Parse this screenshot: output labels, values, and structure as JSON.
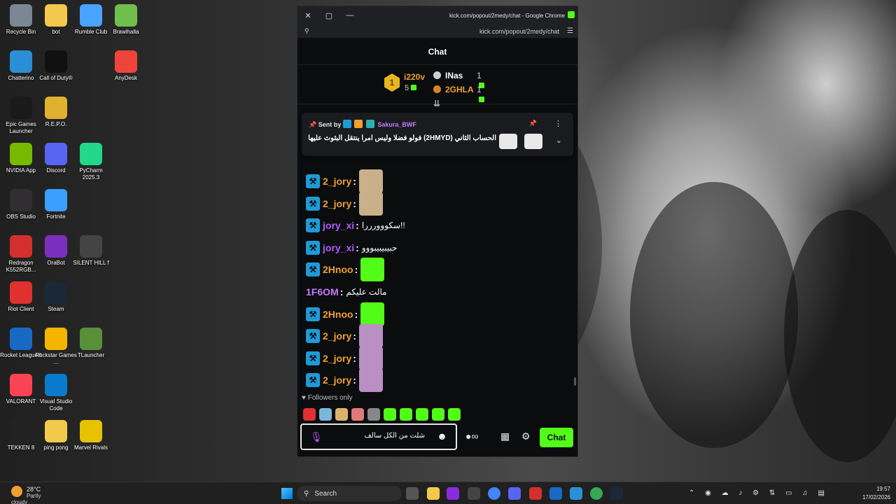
{
  "desktop": {
    "icons": [
      {
        "label": "Recycle Bin",
        "color": "#7b8794"
      },
      {
        "label": "bot",
        "color": "#f2c94c"
      },
      {
        "label": "Rumble Club",
        "color": "#4aa3ff"
      },
      {
        "label": "Brawlhalla",
        "color": "#6fbf4a"
      },
      {
        "label": "Chatterino",
        "color": "#2b8fd6"
      },
      {
        "label": "Call of Duty®",
        "color": "#111111"
      },
      {
        "label": "AnyDesk",
        "color": "#ef443b"
      },
      {
        "label": "Epic Games Launcher",
        "color": "#1a1a1a"
      },
      {
        "label": "R.E.P.O.",
        "color": "#e0b030"
      },
      {
        "label": "NVIDIA App",
        "color": "#76b900"
      },
      {
        "label": "Discord",
        "color": "#5865f2"
      },
      {
        "label": "PyCharm 2025.3",
        "color": "#21d789"
      },
      {
        "label": "OBS Studio",
        "color": "#302e31"
      },
      {
        "label": "Fortnite",
        "color": "#3aa0ff"
      },
      {
        "label": "Redragon K552RGB...",
        "color": "#d32f2f"
      },
      {
        "label": "OraBot",
        "color": "#7b2fbf"
      },
      {
        "label": "SILENT HILL f",
        "color": "#444444"
      },
      {
        "label": "Riot Client",
        "color": "#e03131"
      },
      {
        "label": "Steam",
        "color": "#1b2838"
      },
      {
        "label": "Rocket League®",
        "color": "#1769c4"
      },
      {
        "label": "Rockstar Games ...",
        "color": "#f5b400"
      },
      {
        "label": "TLauncher",
        "color": "#5a8f3a"
      },
      {
        "label": "VALORANT",
        "color": "#fa4454"
      },
      {
        "label": "Visual Studio Code",
        "color": "#0a7acc"
      },
      {
        "label": "TEKKEN 8",
        "color": "#222222"
      },
      {
        "label": "ping pong",
        "color": "#f2c94c"
      },
      {
        "label": "Marvel Rivals",
        "color": "#e6c200"
      }
    ]
  },
  "browser": {
    "title": "kick.com/popout/2medy/chat - Google Chrome",
    "url": "kick.com/popout/2medy/chat"
  },
  "chat": {
    "header": "Chat",
    "leaderboard": {
      "first": {
        "rank": "1",
        "name": "i220v",
        "count": "5"
      },
      "second": {
        "name": "INas",
        "count": "1"
      },
      "third": {
        "name": "2GHLA",
        "count": "1"
      }
    },
    "pinned": {
      "sent_by_label": "Sent by",
      "user": "Sakura_BWF",
      "message": "فولو فضلا وليس امرا ينتقل البثوث عليها (2HMYD) الحساب الثاني"
    },
    "messages": [
      {
        "user": "2_jory",
        "color": "#f0a030",
        "mod": true,
        "emote": "#c9b08a"
      },
      {
        "user": "2_jory",
        "color": "#f0a030",
        "mod": true,
        "emote": "#c9b08a"
      },
      {
        "user": "jory_xi",
        "color": "#b05cff",
        "mod": true,
        "text": "سكووورررا!!"
      },
      {
        "user": "jory_xi",
        "color": "#b05cff",
        "mod": true,
        "text": "حبيبيبيبووو"
      },
      {
        "user": "2Hnoo",
        "color": "#f0a030",
        "mod": true,
        "emote": "#53fc18"
      },
      {
        "user": "1F6OM",
        "color": "#c47cff",
        "mod": false,
        "text": "مالت عليكم"
      },
      {
        "user": "2Hnoo",
        "color": "#f0a030",
        "mod": true,
        "emote": "#53fc18"
      },
      {
        "user": "2_jory",
        "color": "#f0a030",
        "mod": true,
        "emote": "#b98fc4"
      },
      {
        "user": "2_jory",
        "color": "#f0a030",
        "mod": true,
        "emote": "#b98fc4"
      },
      {
        "user": "2_jory",
        "color": "#f0a030",
        "mod": true,
        "emote": "#b98fc4"
      }
    ],
    "followers_only": "Followers only",
    "emote_bar": [
      "#e03131",
      "#7ab8d9",
      "#d9b36a",
      "#e07a7a",
      "#888888",
      "#53fc18",
      "#53fc18",
      "#53fc18",
      "#53fc18",
      "#53fc18"
    ],
    "input_value": "شلت من الكل سالف",
    "send_label": "Chat",
    "accent": "#53fc18"
  },
  "taskbar": {
    "weather_temp": "28°C",
    "weather_desc": "Partly cloudy",
    "search_label": "Search",
    "time": "19:57",
    "date": "17/02/2026"
  }
}
